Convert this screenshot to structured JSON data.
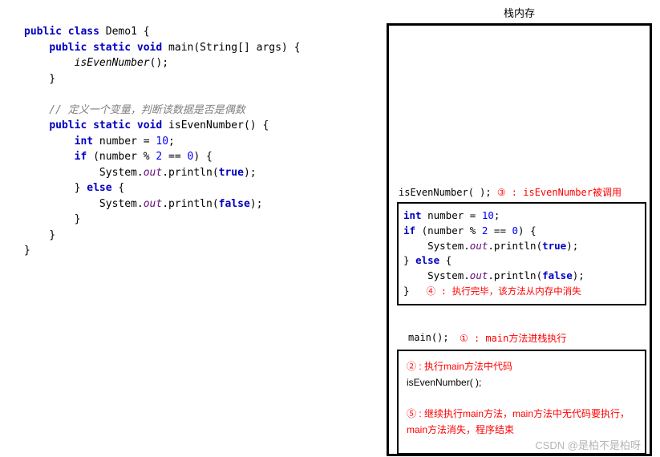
{
  "code": {
    "l1_kw1": "public",
    "l1_kw2": "class",
    "l1_cls": " Demo1 {",
    "l2_kw1": "public",
    "l2_kw2": "static",
    "l2_kw3": "void",
    "l2_rest": " main(String[] args) {",
    "l3_call": "isEvenNumber",
    "l3_rest": "();",
    "l4": "    }",
    "comment": "    // 定义一个变量，判断该数据是否是偶数",
    "l5_kw1": "public",
    "l5_kw2": "static",
    "l5_kw3": "void",
    "l5_rest": " isEvenNumber() {",
    "l6_kw": "int",
    "l6_rest": " number = ",
    "l6_num": "10",
    "l6_end": ";",
    "l7_kw": "if",
    "l7_a": " (number % ",
    "l7_n1": "2",
    "l7_b": " == ",
    "l7_n2": "0",
    "l7_c": ") {",
    "l8_a": "            System.",
    "l8_sf": "out",
    "l8_b": ".println(",
    "l8_kw": "true",
    "l8_c": ");",
    "l9_a": "        } ",
    "l9_kw": "else",
    "l9_b": " {",
    "l10_a": "            System.",
    "l10_sf": "out",
    "l10_b": ".println(",
    "l10_kw": "false",
    "l10_c": ");",
    "l11": "        }",
    "l12": "    }",
    "l13": "}"
  },
  "stack": {
    "title": "栈内存",
    "call1": "isEvenNumber( );",
    "ann3": "③ : isEvenNumber被调用",
    "box1": {
      "l1_kw": "int",
      "l1_a": " number = ",
      "l1_n": "10",
      "l1_b": ";",
      "l2_kw": "if",
      "l2_a": " (number % ",
      "l2_n1": "2",
      "l2_b": " == ",
      "l2_n2": "0",
      "l2_c": ") {",
      "l3_a": "    System.",
      "l3_sf": "out",
      "l3_b": ".println(",
      "l3_kw": "true",
      "l3_c": ");",
      "l4_a": "} ",
      "l4_kw": "else",
      "l4_b": " {",
      "l5_a": "    System.",
      "l5_sf": "out",
      "l5_b": ".println(",
      "l5_kw": "false",
      "l5_c": ");",
      "l6": "}",
      "note4": " ④ : 执行完毕，该方法从内存中消失"
    },
    "main_label": "main();",
    "ann1": "① : main方法进栈执行",
    "box2": {
      "ann2": "② : 执行main方法中代码",
      "call": "isEvenNumber( );",
      "ann5": "⑤ : 继续执行main方法，main方法中无代码要执行，main方法消失，程序结束"
    }
  },
  "watermark": "CSDN @是柏不是柏呀"
}
